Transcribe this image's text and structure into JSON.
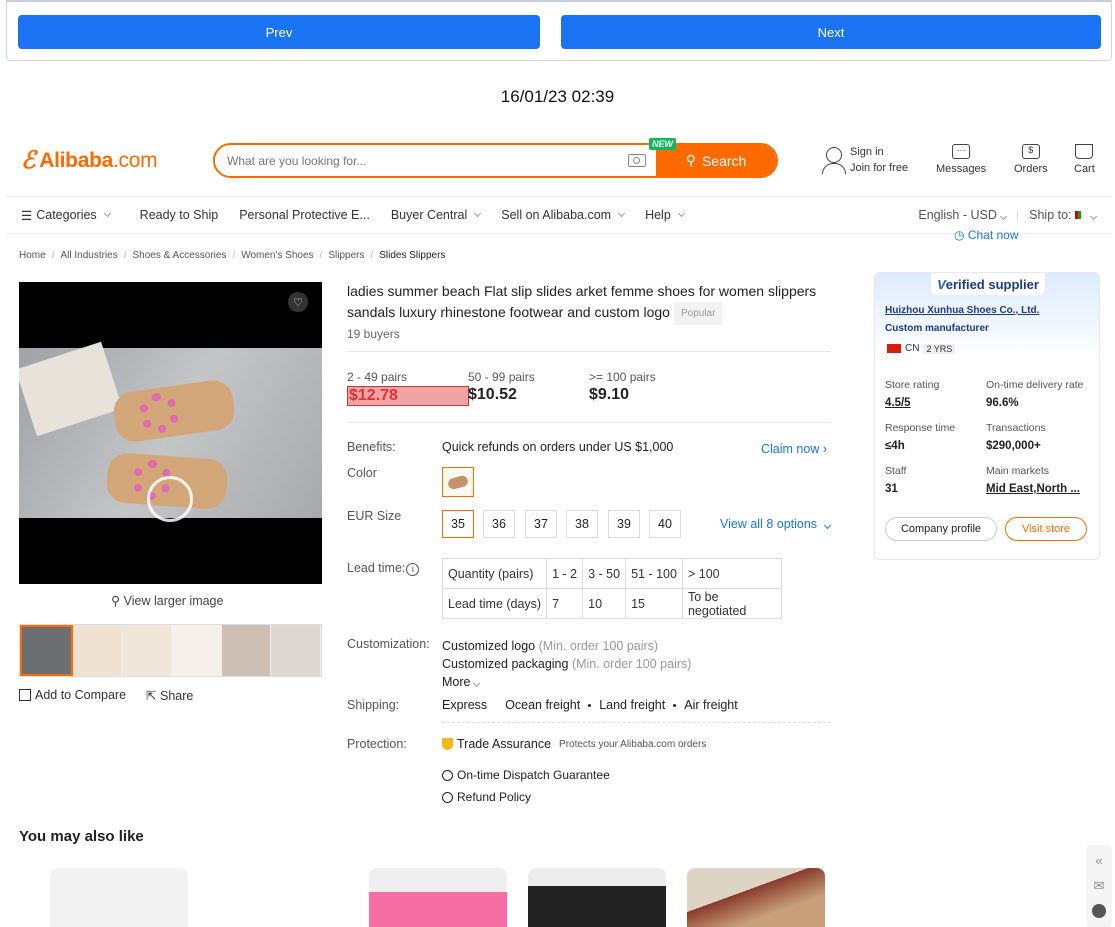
{
  "viewer": {
    "prev_label": "Prev",
    "next_label": "Next",
    "timestamp": "16/01/23 02:39"
  },
  "header": {
    "logo_brand": "Alibaba",
    "logo_suffix": ".com",
    "search_placeholder": "What are you looking for...",
    "new_badge": "NEW",
    "search_button": "Search",
    "sign_in": "Sign in",
    "join": "Join for free",
    "messages": "Messages",
    "orders": "Orders",
    "cart": "Cart"
  },
  "nav": {
    "categories": "Categories",
    "items": [
      "Ready to Ship",
      "Personal Protective E...",
      "Buyer Central",
      "Sell on Alibaba.com",
      "Help"
    ],
    "language": "English - USD",
    "ship_to": "Ship to:",
    "chat_now": "Chat now"
  },
  "breadcrumb": [
    "Home",
    "All Industries",
    "Shoes & Accessories",
    "Women's Shoes",
    "Slippers",
    "Slides Slippers"
  ],
  "gallery": {
    "view_larger": "View larger image",
    "add_compare": "Add to Compare",
    "share": "Share"
  },
  "product": {
    "title": "ladies summer beach Flat slip slides arket femme shoes for women slippers sandals luxury rhinestone footwear and custom logo",
    "popular_badge": "Popular",
    "buyers": "19 buyers",
    "tiers": [
      {
        "range": "2 - 49 pairs",
        "price": "$12.78"
      },
      {
        "range": "50 - 99 pairs",
        "price": "$10.52"
      },
      {
        "range": ">= 100 pairs",
        "price": "$9.10"
      }
    ],
    "benefits_label": "Benefits:",
    "benefits_text": "Quick refunds on orders under US $1,000",
    "claim_now": "Claim now",
    "color_label": "Color",
    "size_label": "EUR Size",
    "sizes": [
      "35",
      "36",
      "37",
      "38",
      "39",
      "40"
    ],
    "view_all": "View all 8 options",
    "lead_label": "Lead time:",
    "lead_table": {
      "row1": [
        "Quantity (pairs)",
        "1 - 2",
        "3 - 50",
        "51 - 100",
        "> 100"
      ],
      "row2": [
        "Lead time (days)",
        "7",
        "10",
        "15",
        "To be negotiated"
      ]
    },
    "custom_label": "Customization:",
    "custom1": "Customized logo",
    "custom1_note": "(Min. order 100 pairs)",
    "custom2": "Customized packaging",
    "custom2_note": "(Min. order 100 pairs)",
    "more": "More",
    "shipping_label": "Shipping:",
    "shipping": [
      "Express",
      "Ocean freight",
      "Land freight",
      "Air freight"
    ],
    "protection_label": "Protection:",
    "trade_assurance": "Trade Assurance",
    "trade_note": "Protects your Alibaba.com orders",
    "dispatch": "On-time Dispatch Guarantee",
    "refund": "Refund Policy"
  },
  "also_like": "You may also like",
  "supplier": {
    "badge_v": "V",
    "badge_rest": "erified supplier",
    "name": "Huizhou Xunhua Shoes Co., Ltd.",
    "type": "Custom manufacturer",
    "country": "CN",
    "years": "2 YRS",
    "store_rating_label": "Store rating",
    "store_rating": "4.5/5",
    "delivery_label": "On-time delivery rate",
    "delivery": "96.6%",
    "response_label": "Response time",
    "response": "≤4h",
    "transactions_label": "Transactions",
    "transactions": "$290,000+",
    "staff_label": "Staff",
    "staff": "31",
    "markets_label": "Main markets",
    "markets": "Mid East,North ...",
    "company_profile": "Company profile",
    "visit_store": "Visit store"
  },
  "colors": {
    "accent": "#ff6a00",
    "link": "#1a73f2",
    "nav_button": "#1a73f2"
  }
}
